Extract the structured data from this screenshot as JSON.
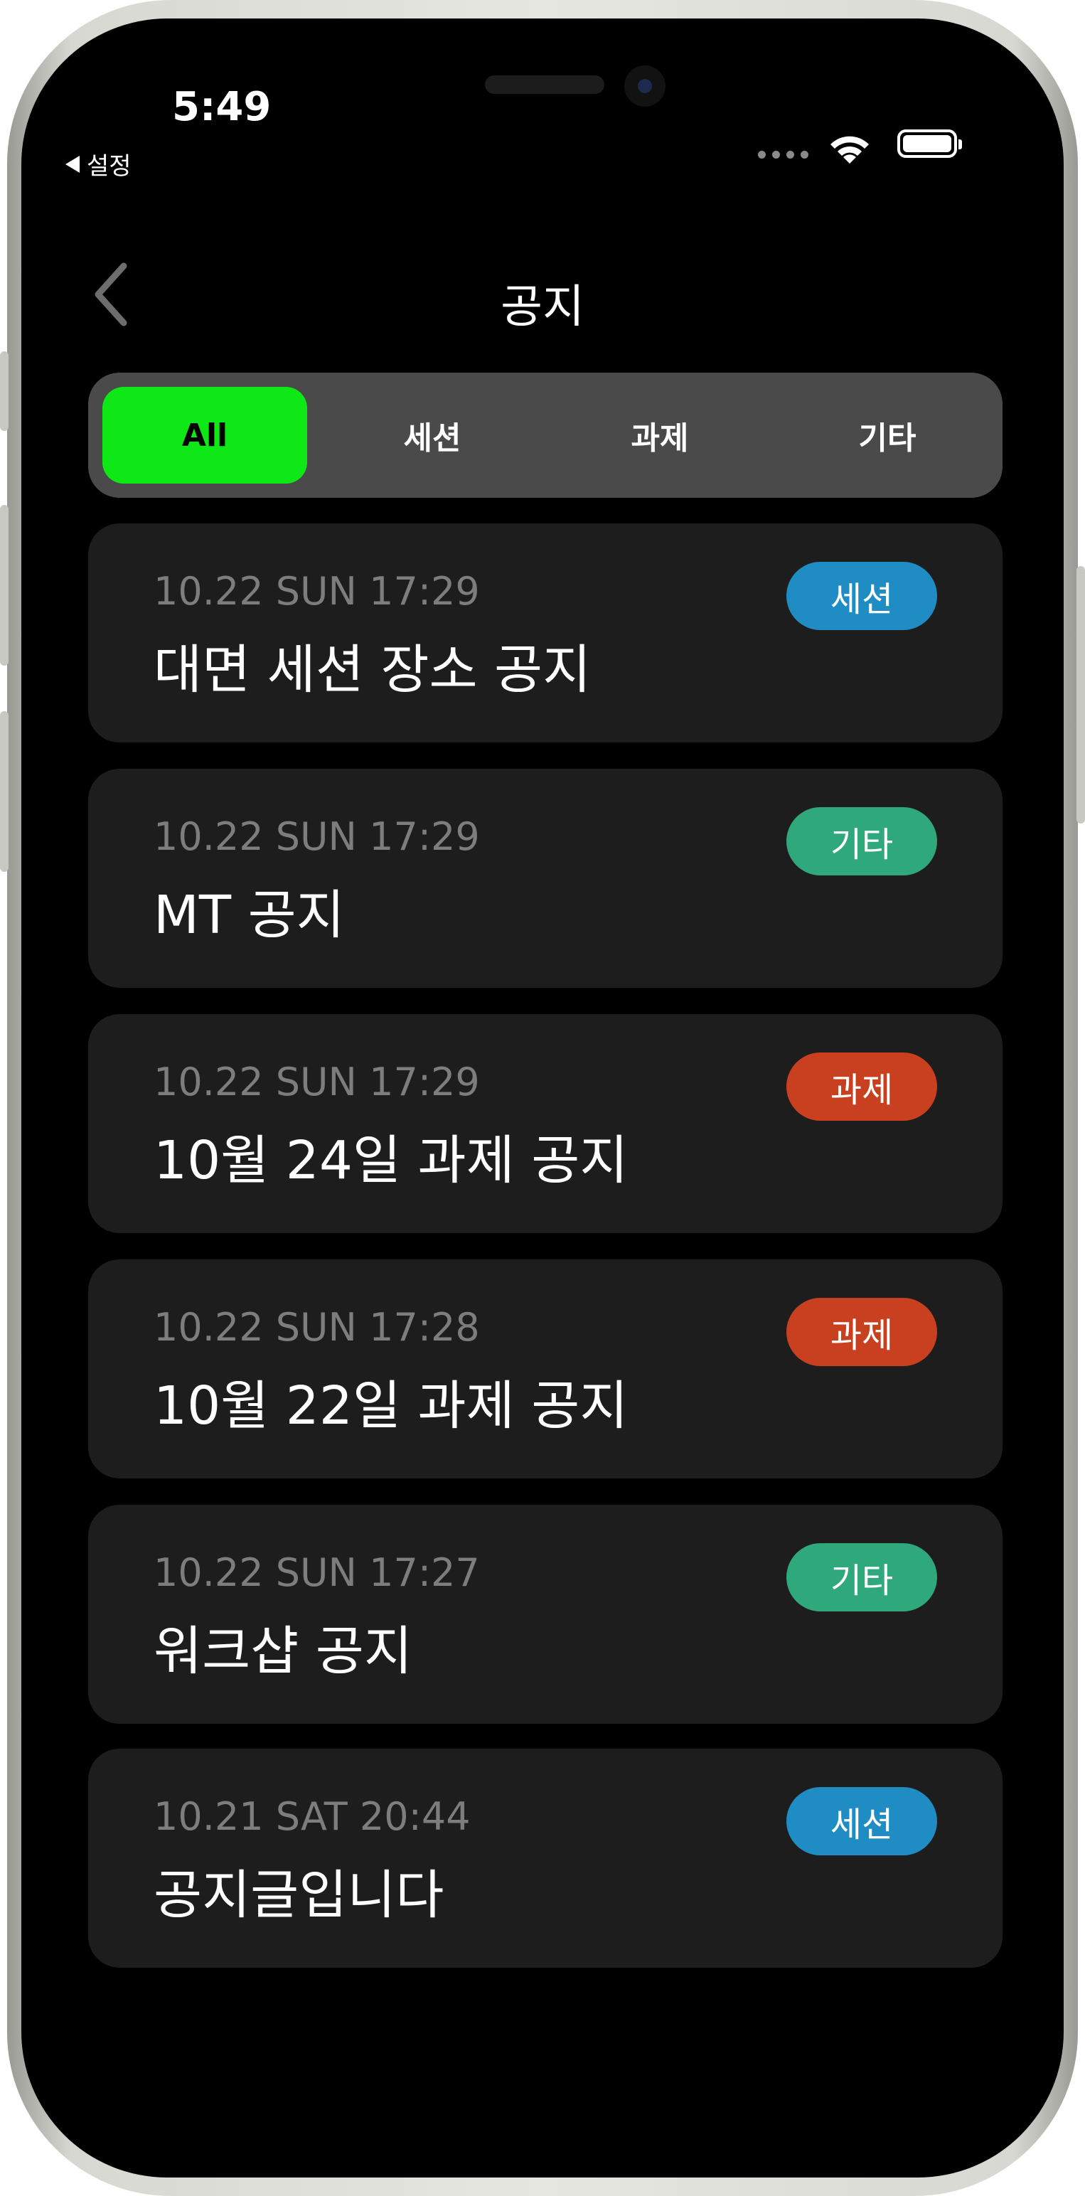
{
  "status_bar": {
    "time": "5:49",
    "back_app_label": "설정"
  },
  "nav": {
    "title": "공지",
    "back_icon": "chevron-left-icon"
  },
  "segments": {
    "selected": "All",
    "items": [
      {
        "label": "All"
      },
      {
        "label": "세션"
      },
      {
        "label": "과제"
      },
      {
        "label": "기타"
      }
    ]
  },
  "categories": {
    "세션": {
      "color": "#1f8dc4"
    },
    "과제": {
      "color": "#c8401f"
    },
    "기타": {
      "color": "#2fa87c"
    }
  },
  "notices": [
    {
      "date": "10.22 SUN 17:29",
      "title": "대면 세션 장소 공지",
      "category": "세션",
      "badge_color": "#1f8dc4"
    },
    {
      "date": "10.22 SUN 17:29",
      "title": "MT 공지",
      "category": "기타",
      "badge_color": "#2fa87c"
    },
    {
      "date": "10.22 SUN 17:29",
      "title": "10월 24일 과제 공지",
      "category": "과제",
      "badge_color": "#c8401f"
    },
    {
      "date": "10.22 SUN 17:28",
      "title": "10월 22일 과제 공지",
      "category": "과제",
      "badge_color": "#c8401f"
    },
    {
      "date": "10.22 SUN 17:27",
      "title": "워크샵 공지",
      "category": "기타",
      "badge_color": "#2fa87c"
    },
    {
      "date": "10.21 SAT 20:44",
      "title": "공지글입니다",
      "category": "세션",
      "badge_color": "#1f8dc4"
    }
  ],
  "colors": {
    "accent": "#0de816",
    "background": "#000000",
    "card": "#1d1d1d",
    "segment_bg": "#4a4a4a"
  }
}
